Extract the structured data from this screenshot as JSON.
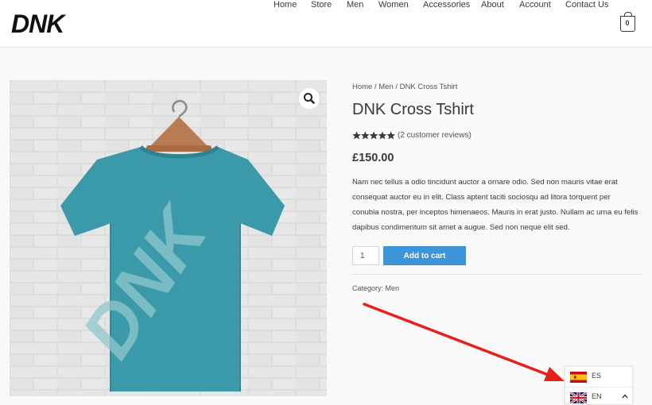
{
  "header": {
    "logo_text": "DNK",
    "nav": [
      {
        "label": "Home"
      },
      {
        "label": "Store"
      },
      {
        "label": "Men"
      },
      {
        "label": "Women"
      },
      {
        "label": "Accessories"
      },
      {
        "label": "About"
      },
      {
        "label": "Account"
      },
      {
        "label": "Contact Us"
      }
    ],
    "cart_count": "0",
    "cart_icon": "shopping-bag-icon"
  },
  "product": {
    "image_print_text": "DNK",
    "image_icon": "zoom-magnifier-icon",
    "breadcrumb": {
      "home": "Home",
      "separator": " / ",
      "category": "Men",
      "current": "DNK Cross Tshirt"
    },
    "title": "DNK Cross Tshirt",
    "rating": 5,
    "rating_max": 5,
    "reviews_text": "(2 customer reviews)",
    "price": "£150.00",
    "description_lines": [
      "Nam nec tellus a odio tincidunt auctor a ornare odio. Sed non mauris vitae erat",
      "consequat auctor eu in elit. Class aptent taciti sociosqu ad litora torquent per",
      "conubia nostra, per inceptos himenaeos. Mauris in erat justo. Nullam ac urna eu felis",
      "dapibus condimentum sit amet a augue. Sed non neque elit sed."
    ],
    "quantity": "1",
    "add_to_cart_label": "Add to cart",
    "category_label": "Category:",
    "category_value": "Men"
  },
  "language_switcher": {
    "options": [
      {
        "code": "ES",
        "flag": "spain-flag-icon"
      },
      {
        "code": "EN",
        "flag": "uk-flag-icon",
        "selected": true
      }
    ],
    "toggle_icon": "chevron-up-icon"
  },
  "colors": {
    "accent": "#3b95d8",
    "text": "#3a3a3a",
    "page_background": "#f9f9f9",
    "shirt": "#3a9aaa",
    "annotation_arrow": "#e8201c"
  }
}
